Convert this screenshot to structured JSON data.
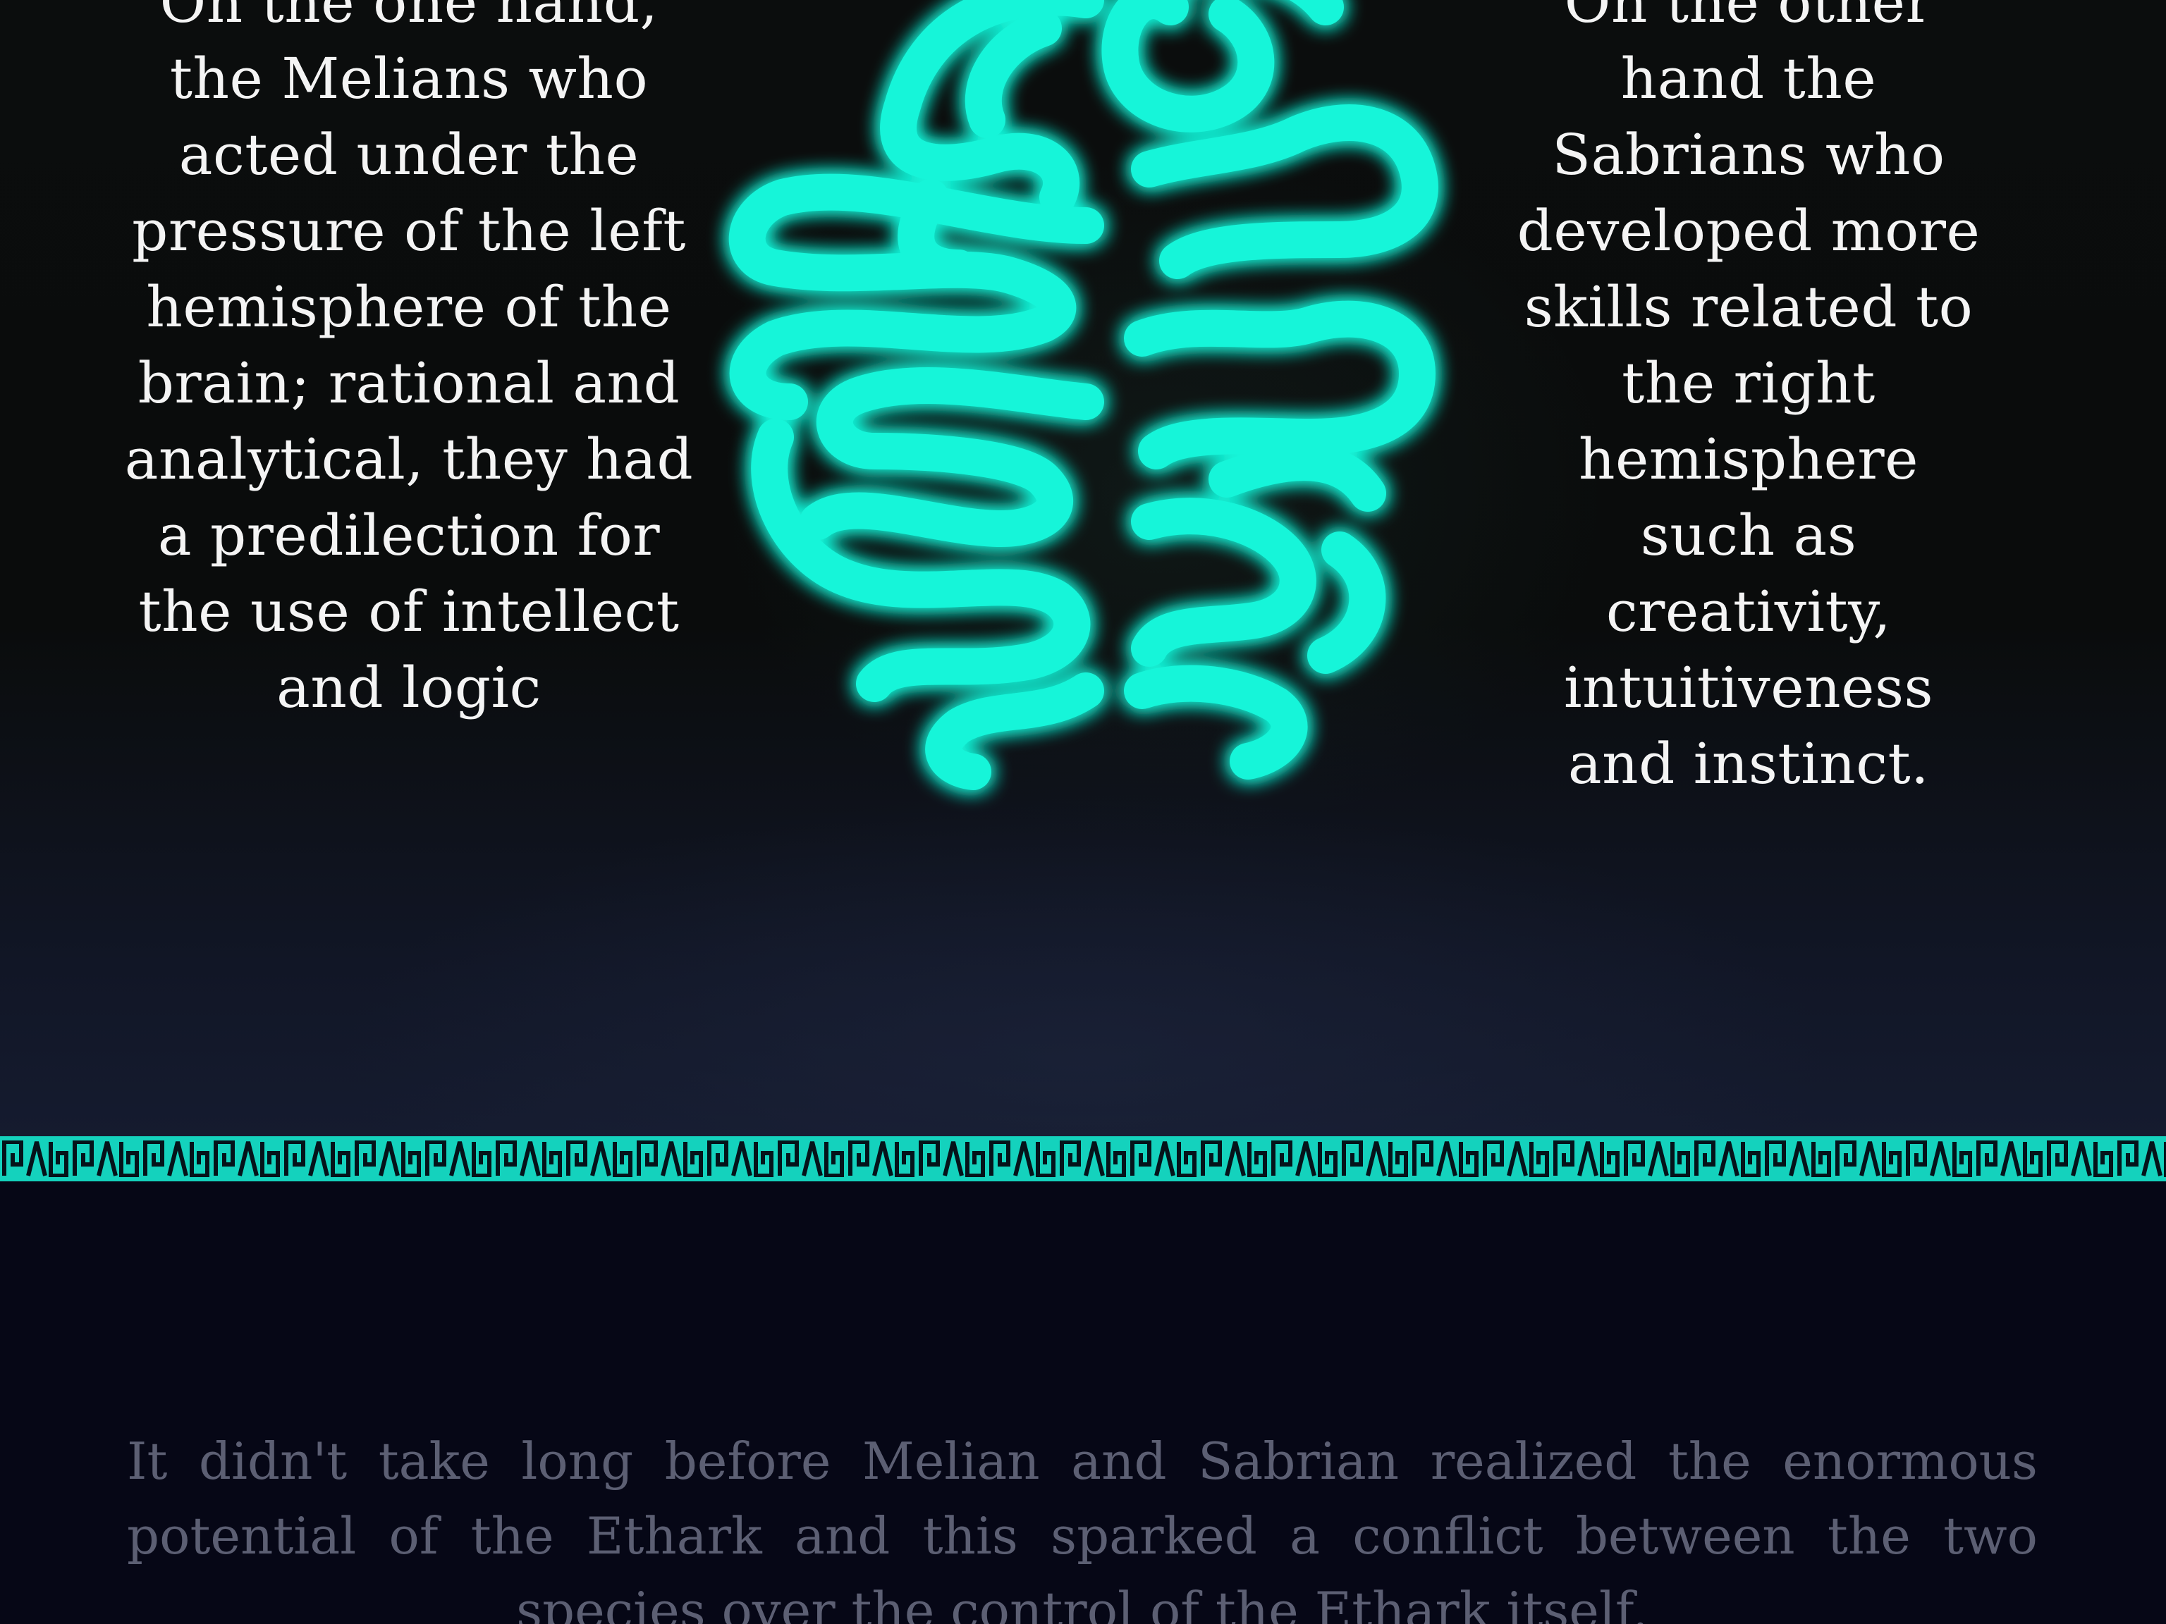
{
  "left_panel": {
    "text": "On the one hand, the Melians who acted under the pressure of the left hemisphere of the brain; rational and analytical, they had a predilection for the use of intellect and logic"
  },
  "right_panel": {
    "text": "On the other hand the Sabrians who developed more skills related to the right hemisphere such as creativity, intuitiveness and instinct."
  },
  "bottom_panel": {
    "text": "It didn't take long before Melian and Sabrian realized the enormous potential of the Ethark and this sparked a conflict between the two species over the control of the Ethark itself."
  },
  "colors": {
    "glow": "#19f5d9",
    "band": "#14d2bd",
    "text_light": "#f4f4f4",
    "text_dim": "#5c5f73",
    "background_top": "#0a0c0c",
    "background_bottom": "#060716"
  },
  "icons": {
    "brain": "glowing-brain-icon",
    "border": "meander-pattern"
  }
}
